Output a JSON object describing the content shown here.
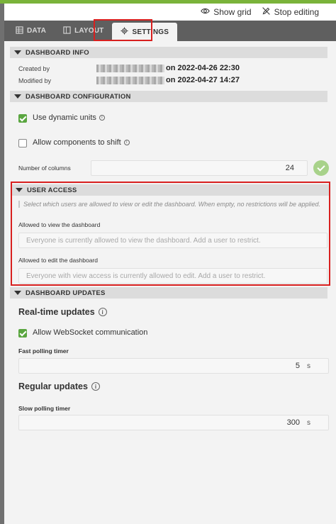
{
  "top_actions": {
    "show_grid": "Show grid",
    "stop_editing": "Stop editing"
  },
  "tabs": [
    {
      "label": "DATA",
      "icon": "table-icon"
    },
    {
      "label": "LAYOUT",
      "icon": "layout-icon"
    },
    {
      "label": "SETTINGS",
      "icon": "gear-icon",
      "active": true
    }
  ],
  "dashboard_info": {
    "header": "DASHBOARD INFO",
    "created_by_label": "Created by",
    "created_by_value": "on 2022-04-26 22:30",
    "modified_by_label": "Modified by",
    "modified_by_value": "on 2022-04-27 14:27"
  },
  "dashboard_configuration": {
    "header": "DASHBOARD CONFIGURATION",
    "dynamic_units_label": "Use dynamic units",
    "dynamic_units_checked": true,
    "allow_shift_label": "Allow components to shift",
    "allow_shift_checked": false,
    "columns_label": "Number of columns",
    "columns_value": "24"
  },
  "user_access": {
    "header": "USER ACCESS",
    "helper": "Select which users are allowed to view or edit the dashboard. When empty, no restrictions will be applied.",
    "view_label": "Allowed to view the dashboard",
    "view_placeholder": "Everyone is currently allowed to view the dashboard. Add a user to restrict.",
    "edit_label": "Allowed to edit the dashboard",
    "edit_placeholder": "Everyone with view access is currently allowed to edit. Add a user to restrict."
  },
  "dashboard_updates": {
    "header": "DASHBOARD UPDATES",
    "realtime_heading": "Real-time updates",
    "websocket_label": "Allow WebSocket communication",
    "websocket_checked": true,
    "fast_label": "Fast polling timer",
    "fast_value": "5",
    "fast_unit": "s",
    "regular_heading": "Regular updates",
    "slow_label": "Slow polling timer",
    "slow_value": "300",
    "slow_unit": "s"
  },
  "colors": {
    "accent_green": "#5aa640",
    "highlight_red": "#d8201f",
    "tab_bar": "#5f5f5f"
  }
}
